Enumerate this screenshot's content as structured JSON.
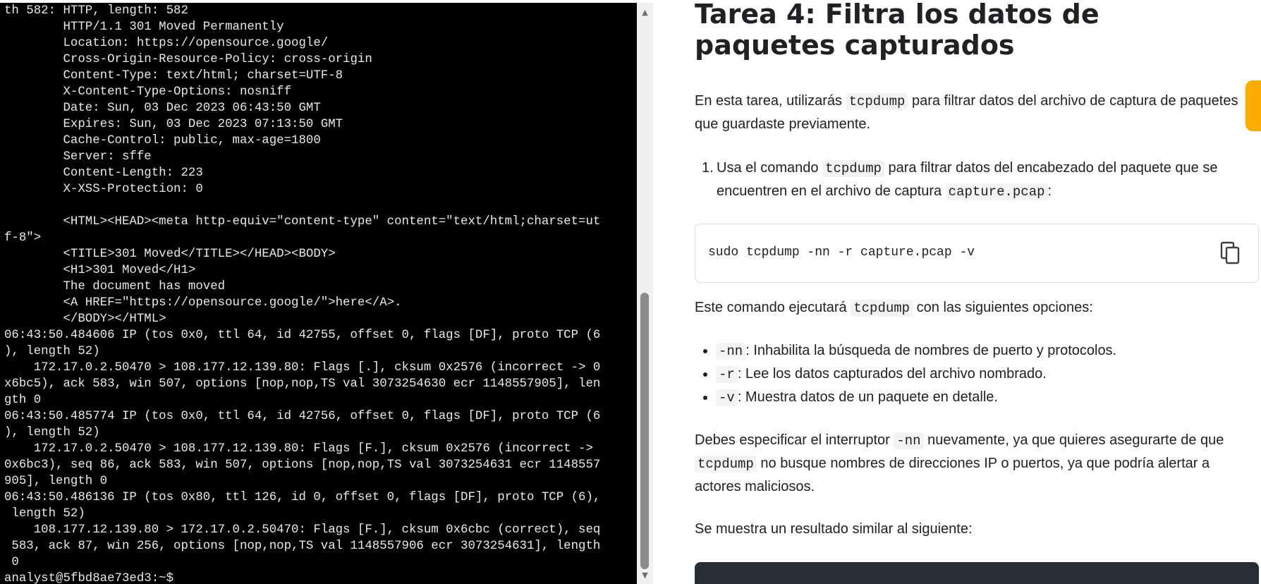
{
  "terminal": {
    "lines": [
      "th 582: HTTP, length: 582",
      "        HTTP/1.1 301 Moved Permanently",
      "        Location: https://opensource.google/",
      "        Cross-Origin-Resource-Policy: cross-origin",
      "        Content-Type: text/html; charset=UTF-8",
      "        X-Content-Type-Options: nosniff",
      "        Date: Sun, 03 Dec 2023 06:43:50 GMT",
      "        Expires: Sun, 03 Dec 2023 07:13:50 GMT",
      "        Cache-Control: public, max-age=1800",
      "        Server: sffe",
      "        Content-Length: 223",
      "        X-XSS-Protection: 0",
      "",
      "        <HTML><HEAD><meta http-equiv=\"content-type\" content=\"text/html;charset=ut",
      "f-8\">",
      "        <TITLE>301 Moved</TITLE></HEAD><BODY>",
      "        <H1>301 Moved</H1>",
      "        The document has moved",
      "        <A HREF=\"https://opensource.google/\">here</A>.",
      "        </BODY></HTML>",
      "06:43:50.484606 IP (tos 0x0, ttl 64, id 42755, offset 0, flags [DF], proto TCP (6",
      "), length 52)",
      "    172.17.0.2.50470 > 108.177.12.139.80: Flags [.], cksum 0x2576 (incorrect -> 0",
      "x6bc5), ack 583, win 507, options [nop,nop,TS val 3073254630 ecr 1148557905], len",
      "gth 0",
      "06:43:50.485774 IP (tos 0x0, ttl 64, id 42756, offset 0, flags [DF], proto TCP (6",
      "), length 52)",
      "    172.17.0.2.50470 > 108.177.12.139.80: Flags [F.], cksum 0x2576 (incorrect ->",
      "0x6bc3), seq 86, ack 583, win 507, options [nop,nop,TS val 3073254631 ecr 1148557",
      "905], length 0",
      "06:43:50.486136 IP (tos 0x80, ttl 126, id 0, offset 0, flags [DF], proto TCP (6),",
      " length 52)",
      "    108.177.12.139.80 > 172.17.0.2.50470: Flags [F.], cksum 0x6cbc (correct), seq",
      " 583, ack 87, win 256, options [nop,nop,TS val 1148557906 ecr 3073254631], length",
      " 0",
      "analyst@5fbd8ae73ed3:~$ "
    ]
  },
  "doc": {
    "title": "Tarea 4: Filtra los datos de paquetes capturados",
    "intro": {
      "before": "En esta tarea, utilizarás ",
      "code": "tcpdump",
      "after": " para filtrar datos del archivo de captura de paquetes que guardaste previamente."
    },
    "step1": {
      "num": "1.",
      "a": "Usa el comando ",
      "code1": "tcpdump",
      "b": " para filtrar datos del encabezado del paquete que se encuentren en el archivo de captura ",
      "code2": "capture.pcap",
      "c": ":"
    },
    "command": "sudo tcpdump -nn -r capture.pcap -v",
    "copy_icon": "copy-icon",
    "options_intro": {
      "a": "Este comando ejecutará ",
      "code": "tcpdump",
      "b": " con las siguientes opciones:"
    },
    "options": [
      {
        "flag": "-nn",
        "desc": ": Inhabilita la búsqueda de nombres de puerto y protocolos."
      },
      {
        "flag": "-r",
        "desc": ": Lee los datos capturados del archivo nombrado."
      },
      {
        "flag": "-v",
        "desc": ": Muestra datos de un paquete en detalle."
      }
    ],
    "note": {
      "a": "Debes especificar el interruptor ",
      "code1": "-nn",
      "b": " nuevamente, ya que quieres asegurarte de que ",
      "code2": "tcpdump",
      "c": " no busque nombres de direcciones IP o puertos, ya que podría alertar a actores maliciosos."
    },
    "result_intro": "Se muestra un resultado similar al siguiente:"
  },
  "colors": {
    "terminal_bg": "#000000",
    "terminal_fg": "#e9e9e9",
    "accent_tab": "#f9ab00",
    "code_bg": "#f1f3f4"
  }
}
